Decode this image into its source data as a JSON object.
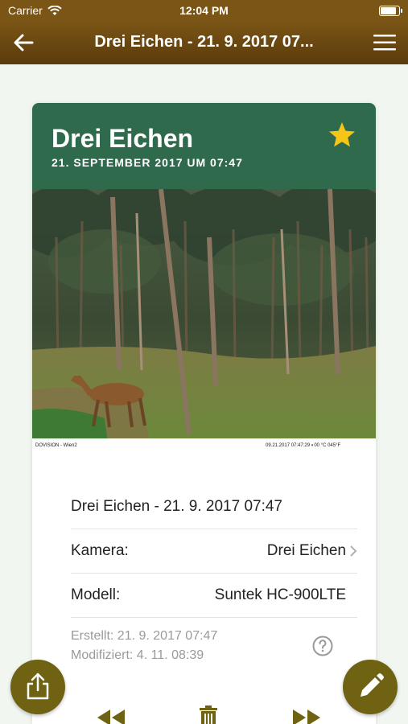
{
  "status_bar": {
    "carrier": "Carrier",
    "time": "12:04 PM"
  },
  "nav": {
    "title": "Drei Eichen - 21. 9. 2017 07...",
    "back_icon": "back-arrow-icon",
    "menu_icon": "hamburger-menu-icon"
  },
  "card": {
    "name": "Drei Eichen",
    "date": "21. SEPTEMBER 2017 UM 07:47",
    "favorite": true,
    "photo_caption_left": "DOVISION - Wien2",
    "photo_caption_right": "09.21.2017 07:47:29  ◐00 °C 045°F"
  },
  "details": {
    "title": "Drei Eichen - 21. 9. 2017 07:47",
    "camera_label": "Kamera:",
    "camera_value": "Drei Eichen",
    "model_label": "Modell:",
    "model_value": "Suntek HC-900LTE",
    "created": "Erstellt: 21. 9. 2017 07:47",
    "modified": "Modifiziert: 4. 11. 08:39"
  },
  "colors": {
    "nav_brown": "#7b5516",
    "header_green": "#2f6a4c",
    "star_yellow": "#f5c518",
    "fab_olive": "#6f6212"
  }
}
